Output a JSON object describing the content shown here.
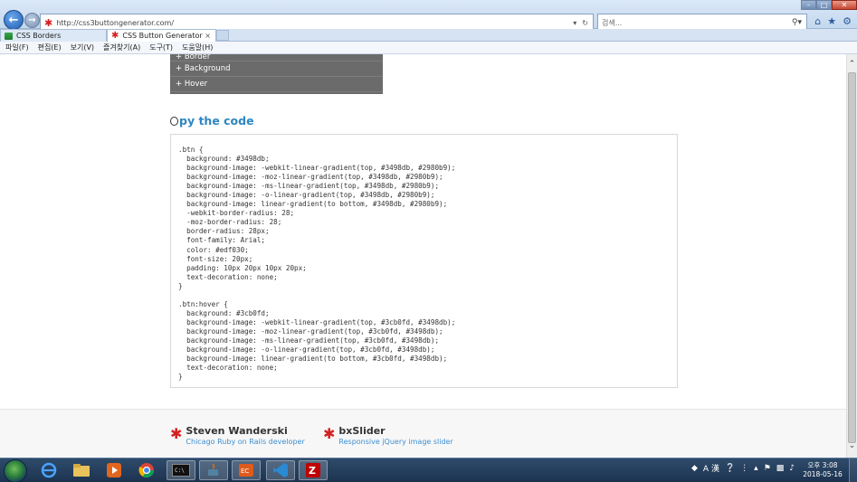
{
  "browser": {
    "url": "http://css3buttongenerator.com/",
    "search_placeholder": "검색...",
    "tabs": [
      {
        "label": "CSS Borders"
      },
      {
        "label": "CSS Button Generator"
      }
    ],
    "menu": [
      "파일(F)",
      "편집(E)",
      "보기(V)",
      "즐겨찾기(A)",
      "도구(T)",
      "도움말(H)"
    ]
  },
  "page": {
    "panel_items": [
      "+ Border",
      "+ Background",
      "+ Hover"
    ],
    "copy_title_rest": "py the code",
    "code": ".btn {\n  background: #3498db;\n  background-image: -webkit-linear-gradient(top, #3498db, #2980b9);\n  background-image: -moz-linear-gradient(top, #3498db, #2980b9);\n  background-image: -ms-linear-gradient(top, #3498db, #2980b9);\n  background-image: -o-linear-gradient(top, #3498db, #2980b9);\n  background-image: linear-gradient(to bottom, #3498db, #2980b9);\n  -webkit-border-radius: 28;\n  -moz-border-radius: 28;\n  border-radius: 28px;\n  font-family: Arial;\n  color: #edf030;\n  font-size: 20px;\n  padding: 10px 20px 10px 20px;\n  text-decoration: none;\n}\n\n.btn:hover {\n  background: #3cb0fd;\n  background-image: -webkit-linear-gradient(top, #3cb0fd, #3498db);\n  background-image: -moz-linear-gradient(top, #3cb0fd, #3498db);\n  background-image: -ms-linear-gradient(top, #3cb0fd, #3498db);\n  background-image: -o-linear-gradient(top, #3cb0fd, #3498db);\n  background-image: linear-gradient(to bottom, #3cb0fd, #3498db);\n  text-decoration: none;\n}",
    "footer": [
      {
        "name": "Steven Wanderski",
        "sub": "Chicago Ruby on Rails developer"
      },
      {
        "name": "bxSlider",
        "sub": "Responsive jQuery image slider"
      }
    ]
  },
  "taskbar": {
    "clock_time": "오후 3:08",
    "clock_date": "2018-05-16",
    "ime": "A 漢"
  },
  "colors": {
    "accent": "#2e86c1",
    "panel": "#6b6b6b",
    "brand_star": "#d42020"
  }
}
